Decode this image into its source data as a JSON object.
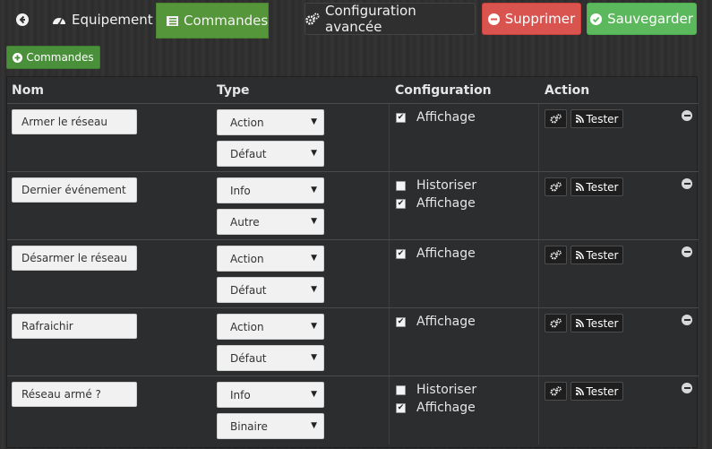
{
  "header": {
    "tabs": [
      {
        "label": "Equipement"
      },
      {
        "label": "Commandes"
      }
    ],
    "buttons": {
      "advanced_config": "Configuration avancée",
      "delete": "Supprimer",
      "save": "Sauvegarder"
    }
  },
  "add_button_label": "Commandes",
  "table": {
    "columns": [
      "Nom",
      "Type",
      "Configuration",
      "Action"
    ],
    "rows": [
      {
        "name": "Armer le réseau",
        "type": "Action",
        "subtype": "Défaut",
        "options": [
          {
            "label": "Affichage",
            "checked": true
          }
        ],
        "test_label": "Tester"
      },
      {
        "name": "Dernier événement",
        "type": "Info",
        "subtype": "Autre",
        "options": [
          {
            "label": "Historiser",
            "checked": false
          },
          {
            "label": "Affichage",
            "checked": true
          }
        ],
        "test_label": "Tester"
      },
      {
        "name": "Désarmer le réseau",
        "type": "Action",
        "subtype": "Défaut",
        "options": [
          {
            "label": "Affichage",
            "checked": true
          }
        ],
        "test_label": "Tester"
      },
      {
        "name": "Rafraichir",
        "type": "Action",
        "subtype": "Défaut",
        "options": [
          {
            "label": "Affichage",
            "checked": true
          }
        ],
        "test_label": "Tester"
      },
      {
        "name": "Réseau armé ?",
        "type": "Info",
        "subtype": "Binaire",
        "options": [
          {
            "label": "Historiser",
            "checked": false
          },
          {
            "label": "Affichage",
            "checked": true
          }
        ],
        "test_label": "Tester"
      }
    ]
  },
  "colors": {
    "commandes_tab": "#56963a",
    "delete_button": "#d9534f",
    "save_button": "#5cb85c"
  },
  "icons": {
    "back": "arrow-left-circle-icon",
    "equipment": "dashboard-gauge-icon",
    "commands": "list-icon",
    "advanced_config": "cogs-icon",
    "delete": "minus-circle-icon",
    "save": "check-circle-icon",
    "add": "plus-circle-icon",
    "test": "rss-icon",
    "remove": "minus-circle-icon"
  }
}
